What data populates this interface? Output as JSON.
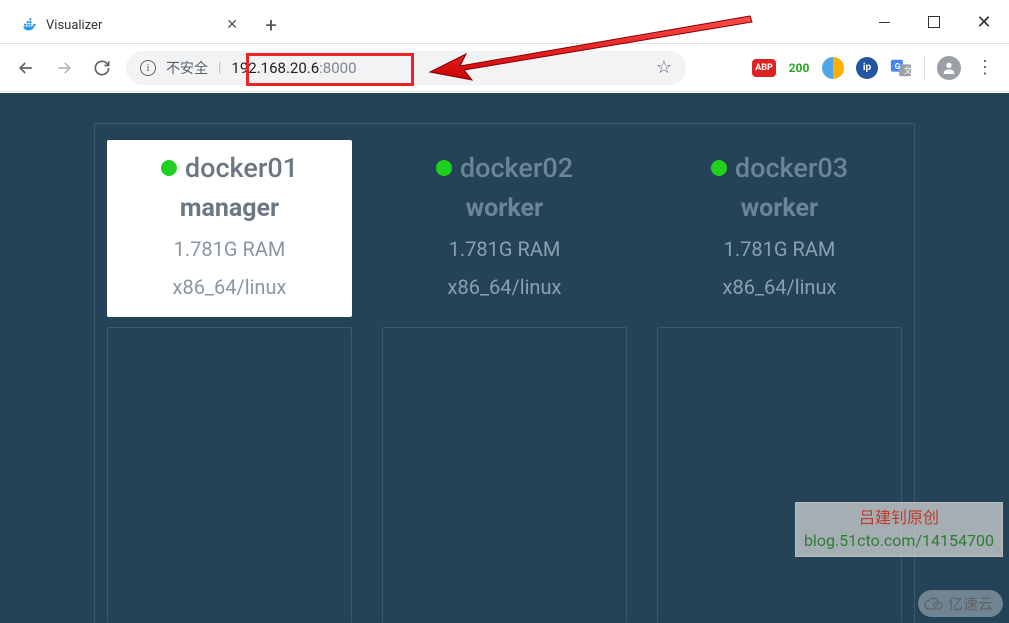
{
  "browser": {
    "tab_title": "Visualizer",
    "address": {
      "unsafe_label": "不安全",
      "host": "192.168.20.6",
      "port": ":8000"
    },
    "extensions": {
      "abp": "ABP",
      "n200": "200"
    }
  },
  "visualizer": {
    "nodes": [
      {
        "name": "docker01",
        "role": "manager",
        "ram": "1.781G RAM",
        "arch": "x86_64/linux",
        "is_manager": true
      },
      {
        "name": "docker02",
        "role": "worker",
        "ram": "1.781G RAM",
        "arch": "x86_64/linux",
        "is_manager": false
      },
      {
        "name": "docker03",
        "role": "worker",
        "ram": "1.781G RAM",
        "arch": "x86_64/linux",
        "is_manager": false
      }
    ]
  },
  "watermark": {
    "line1": "吕建钊原创",
    "line2": "blog.51cto.com/14154700"
  },
  "yisu": "亿速云"
}
